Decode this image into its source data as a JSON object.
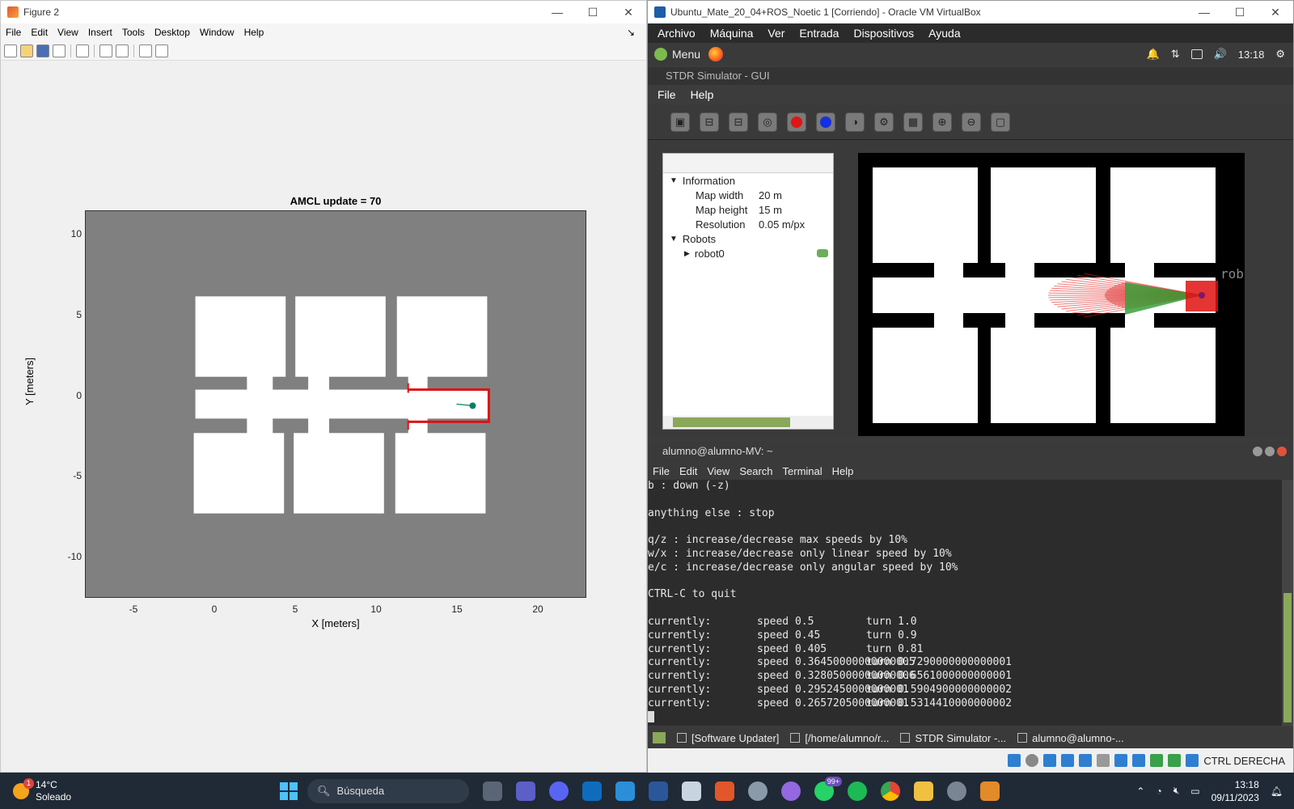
{
  "figure": {
    "window_title": "Figure 2",
    "menu": [
      "File",
      "Edit",
      "View",
      "Insert",
      "Tools",
      "Desktop",
      "Window",
      "Help"
    ],
    "dock_arrow": "↘",
    "plot_title": "AMCL update = 70",
    "xlabel": "X [meters]",
    "ylabel": "Y [meters]",
    "xticks": [
      "-5",
      "0",
      "5",
      "10",
      "15",
      "20"
    ],
    "yticks": [
      "10",
      "5",
      "0",
      "-5",
      "-10"
    ],
    "xlim": [
      -8,
      23
    ],
    "ylim": [
      -12.5,
      11.5
    ],
    "robot_position": [
      16.0,
      -0.6
    ],
    "colors": {
      "axes_bg": "#808080",
      "free_space": "#ffffff",
      "laser": "#e01010",
      "robot": "#00806b"
    }
  },
  "vbox": {
    "window_title": "Ubuntu_Mate_20_04+ROS_Noetic 1 [Corriendo] - Oracle VM VirtualBox",
    "menu": [
      "Archivo",
      "Máquina",
      "Ver",
      "Entrada",
      "Dispositivos",
      "Ayuda"
    ],
    "mate_menu_label": "Menu",
    "mate_clock": "13:18",
    "status_text": "CTRL DERECHA"
  },
  "stdr": {
    "window_title": "STDR Simulator - GUI",
    "menu": [
      "File",
      "Help"
    ],
    "tree": {
      "information_label": "Information",
      "rows": [
        {
          "key": "Map width",
          "value": "20 m"
        },
        {
          "key": "Map height",
          "value": "15 m"
        },
        {
          "key": "Resolution",
          "value": "0.05 m/px"
        }
      ],
      "robots_label": "Robots",
      "robot_name": "robot0"
    },
    "map_robot_label": "rob"
  },
  "terminal": {
    "title": "alumno@alumno-MV: ~",
    "menu": [
      "File",
      "Edit",
      "View",
      "Search",
      "Terminal",
      "Help"
    ],
    "lines": [
      "b : down (-z)",
      "",
      "anything else : stop",
      "",
      "q/z : increase/decrease max speeds by 10%",
      "w/x : increase/decrease only linear speed by 10%",
      "e/c : increase/decrease only angular speed by 10%",
      "",
      "CTRL-C to quit",
      "",
      "currently:\tspeed 0.5\tturn 1.0",
      "currently:\tspeed 0.45\tturn 0.9",
      "currently:\tspeed 0.405\tturn 0.81",
      "currently:\tspeed 0.36450000000000005\tturn 0.7290000000000001",
      "currently:\tspeed 0.32805000000000006\tturn 0.6561000000000001",
      "currently:\tspeed 0.2952450000000001\tturn 0.5904900000000002",
      "currently:\tspeed 0.2657205000000001\tturn 0.5314410000000002"
    ]
  },
  "mate_taskbar": {
    "tasks": [
      "[Software Updater]",
      "[/home/alumno/r...",
      "STDR Simulator -...",
      "alumno@alumno-..."
    ]
  },
  "windows": {
    "temperature": "14°C",
    "weather": "Soleado",
    "weather_badge": "1",
    "search_placeholder": "Búsqueda",
    "whatsapp_badge": "99+",
    "time": "13:18",
    "date": "09/11/2023"
  }
}
